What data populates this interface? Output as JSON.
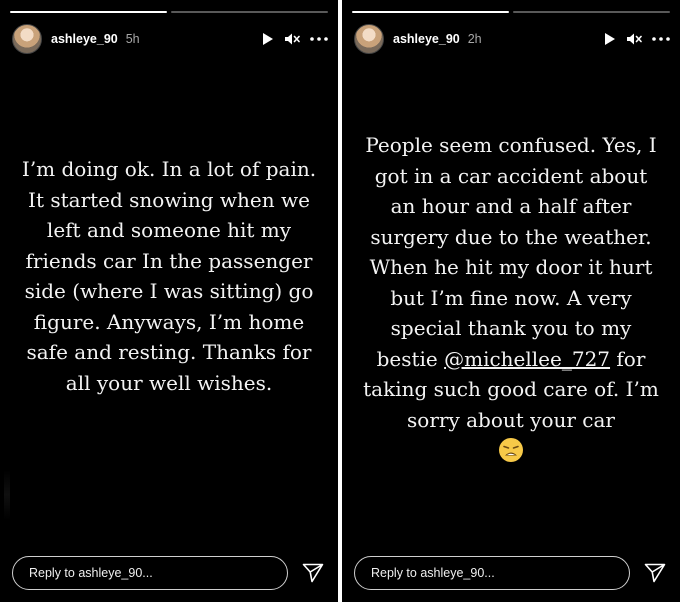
{
  "stories": [
    {
      "username": "ashleye_90",
      "time": "5h",
      "progress": [
        1.0,
        0.0
      ],
      "text": "I’m doing ok. In a lot of pain. It started snowing when we left and someone hit my friends car In the passenger side (where I was sitting) go figure. Anyways, I’m home safe and resting. Thanks for all your well wishes.",
      "reply_placeholder": "Reply to ashleye_90..."
    },
    {
      "username": "ashleye_90",
      "time": "2h",
      "progress": [
        1.0,
        0.0
      ],
      "text_before": "People seem confused. Yes, I got in a car accident about an hour and a half after surgery due to the weather. When he hit my door it hurt but I’m fine now. A very special thank you to my bestie ",
      "mention": "@michellee_727",
      "text_after": " for taking such good care of. I’m sorry about your car",
      "emoji": "weary-face-emoji",
      "reply_placeholder": "Reply to ashleye_90..."
    }
  ],
  "icons": {
    "play": "play-icon",
    "mute": "mute-icon",
    "more": "more-icon",
    "send": "send-icon"
  }
}
